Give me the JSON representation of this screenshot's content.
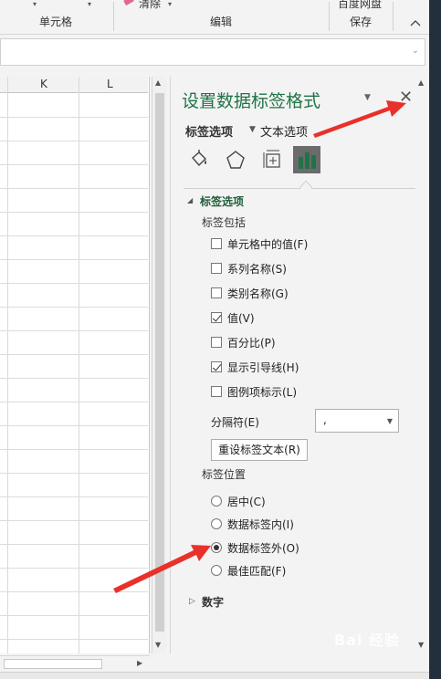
{
  "ribbon": {
    "groups": [
      {
        "label": "单元格"
      },
      {
        "label": "编辑"
      },
      {
        "label": "保存",
        "top_label": "百度网盘"
      }
    ],
    "clear_label": "清除"
  },
  "sheet": {
    "columns": [
      "K",
      "L"
    ]
  },
  "pane": {
    "title": "设置数据标签格式",
    "tabs": [
      {
        "label": "标签选项",
        "active": true
      },
      {
        "label": "文本选项",
        "active": false
      }
    ],
    "icons": [
      "fill-bucket-icon",
      "pentagon-icon",
      "size-properties-icon",
      "bar-chart-icon"
    ],
    "label_options_header": "标签选项",
    "label_contains_title": "标签包括",
    "checkboxes": [
      {
        "label": "单元格中的值(F)",
        "checked": false
      },
      {
        "label": "系列名称(S)",
        "checked": false
      },
      {
        "label": "类别名称(G)",
        "checked": false
      },
      {
        "label": "值(V)",
        "checked": true
      },
      {
        "label": "百分比(P)",
        "checked": false
      },
      {
        "label": "显示引导线(H)",
        "checked": true
      },
      {
        "label": "图例项标示(L)",
        "checked": false
      }
    ],
    "separator_label": "分隔符(E)",
    "separator_value": ",",
    "reset_button": "重设标签文本(R)",
    "label_position_title": "标签位置",
    "radios": [
      {
        "label": "居中(C)",
        "checked": false
      },
      {
        "label": "数据标签内(I)",
        "checked": false
      },
      {
        "label": "数据标签外(O)",
        "checked": true
      },
      {
        "label": "最佳匹配(F)",
        "checked": false
      }
    ],
    "number_section": "数字"
  },
  "watermark": "Bai 经验",
  "colors": {
    "accent": "#217346",
    "arrow": "#e8312a"
  }
}
